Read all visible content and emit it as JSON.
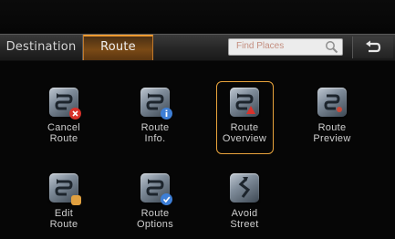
{
  "tabs": [
    {
      "label": "Destination",
      "active": false
    },
    {
      "label": "Route",
      "active": true
    }
  ],
  "search": {
    "placeholder": "Find Places"
  },
  "accent_color": "#f09a30",
  "menu_items": [
    {
      "label": "Cancel\nRoute",
      "icon": "cancel-route-icon",
      "badge_color": "#d8322b",
      "selected": false
    },
    {
      "label": "Route\nInfo.",
      "icon": "route-info-icon",
      "badge_color": "#3e7fd6",
      "selected": false
    },
    {
      "label": "Route\nOverview",
      "icon": "route-overview-icon",
      "badge_color": "#d8322b",
      "selected": true
    },
    {
      "label": "Route\nPreview",
      "icon": "route-preview-icon",
      "badge_color": "#c94a3a",
      "selected": false
    },
    {
      "label": "Edit\nRoute",
      "icon": "edit-route-icon",
      "badge_color": "#e0a040",
      "selected": false
    },
    {
      "label": "Route\nOptions",
      "icon": "route-options-icon",
      "badge_color": "#3e7fd6",
      "selected": false
    },
    {
      "label": "Avoid\nStreet",
      "icon": "avoid-street-icon",
      "badge_color": "",
      "selected": false
    }
  ]
}
